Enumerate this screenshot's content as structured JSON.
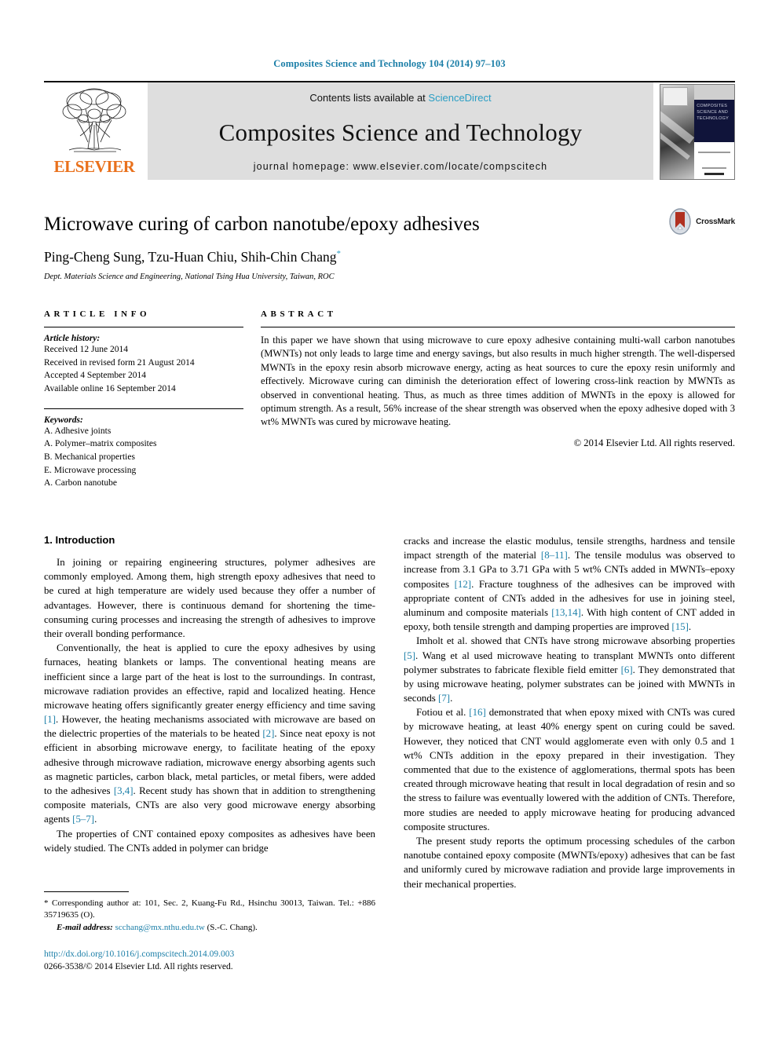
{
  "running_head": "Composites Science and Technology 104 (2014) 97–103",
  "banner": {
    "publisher_name": "ELSEVIER",
    "contents_prefix": "Contents lists available at",
    "contents_link": "ScienceDirect",
    "journal_title": "Composites Science and Technology",
    "homepage_line": "journal homepage: www.elsevier.com/locate/compscitech",
    "cover_title": "COMPOSITES SCIENCE AND TECHNOLOGY"
  },
  "article": {
    "title": "Microwave curing of carbon nanotube/epoxy adhesives",
    "authors": "Ping-Cheng Sung, Tzu-Huan Chiu, Shih-Chin Chang",
    "corresponding_marker": "*",
    "affiliation": "Dept. Materials Science and Engineering, National Tsing Hua University, Taiwan, ROC",
    "crossmark_label": "CrossMark"
  },
  "article_info": {
    "heading": "ARTICLE INFO",
    "history_label": "Article history:",
    "history": [
      "Received 12 June 2014",
      "Received in revised form 21 August 2014",
      "Accepted 4 September 2014",
      "Available online 16 September 2014"
    ],
    "keywords_label": "Keywords:",
    "keywords": [
      "A. Adhesive joints",
      "A. Polymer–matrix composites",
      "B. Mechanical properties",
      "E. Microwave processing",
      "A. Carbon nanotube"
    ]
  },
  "abstract": {
    "heading": "ABSTRACT",
    "text": "In this paper we have shown that using microwave to cure epoxy adhesive containing multi-wall carbon nanotubes (MWNTs) not only leads to large time and energy savings, but also results in much higher strength. The well-dispersed MWNTs in the epoxy resin absorb microwave energy, acting as heat sources to cure the epoxy resin uniformly and effectively. Microwave curing can diminish the deterioration effect of lowering cross-link reaction by MWNTs as observed in conventional heating. Thus, as much as three times addition of MWNTs in the epoxy is allowed for optimum strength. As a result, 56% increase of the shear strength was observed when the epoxy adhesive doped with 3 wt% MWNTs was cured by microwave heating.",
    "copyright": "© 2014 Elsevier Ltd. All rights reserved."
  },
  "body": {
    "section_number_title": "1. Introduction",
    "left_paragraphs": [
      "In joining or repairing engineering structures, polymer adhesives are commonly employed. Among them, high strength epoxy adhesives that need to be cured at high temperature are widely used because they offer a number of advantages. However, there is continuous demand for shortening the time-consuming curing processes and increasing the strength of adhesives to improve their overall bonding performance.",
      "Conventionally, the heat is applied to cure the epoxy adhesives by using furnaces, heating blankets or lamps. The conventional heating means are inefficient since a large part of the heat is lost to the surroundings. In contrast, microwave radiation provides an effective, rapid and localized heating. Hence microwave heating offers significantly greater energy efficiency and time saving [1]. However, the heating mechanisms associated with microwave are based on the dielectric properties of the materials to be heated [2]. Since neat epoxy is not efficient in absorbing microwave energy, to facilitate heating of the epoxy adhesive through microwave radiation, microwave energy absorbing agents such as magnetic particles, carbon black, metal particles, or metal fibers, were added to the adhesives [3,4]. Recent study has shown that in addition to strengthening composite materials, CNTs are also very good microwave energy absorbing agents [5–7].",
      "The properties of CNT contained epoxy composites as adhesives have been widely studied. The CNTs added in polymer can bridge"
    ],
    "right_paragraphs": [
      "cracks and increase the elastic modulus, tensile strengths, hardness and tensile impact strength of the material [8–11]. The tensile modulus was observed to increase from 3.1 GPa to 3.71 GPa with 5 wt% CNTs added in MWNTs–epoxy composites [12]. Fracture toughness of the adhesives can be improved with appropriate content of CNTs added in the adhesives for use in joining steel, aluminum and composite materials [13,14]. With high content of CNT added in epoxy, both tensile strength and damping properties are improved [15].",
      "Imholt et al. showed that CNTs have strong microwave absorbing properties [5]. Wang et al used microwave heating to transplant MWNTs onto different polymer substrates to fabricate flexible field emitter [6]. They demonstrated that by using microwave heating, polymer substrates can be joined with MWNTs in seconds [7].",
      "Fotiou et al. [16] demonstrated that when epoxy mixed with CNTs was cured by microwave heating, at least 40% energy spent on curing could be saved. However, they noticed that CNT would agglomerate even with only 0.5 and 1 wt% CNTs addition in the epoxy prepared in their investigation. They commented that due to the existence of agglomerations, thermal spots has been created through microwave heating that result in local degradation of resin and so the stress to failure was eventually lowered with the addition of CNTs. Therefore, more studies are needed to apply microwave heating for producing advanced composite structures.",
      "The present study reports the optimum processing schedules of the carbon nanotube contained epoxy composite (MWNTs/epoxy) adhesives that can be fast and uniformly cured by microwave radiation and provide large improvements in their mechanical properties."
    ]
  },
  "footnote": {
    "corresponding_marker": "*",
    "corresponding_text": "Corresponding author at: 101, Sec. 2, Kuang-Fu Rd., Hsinchu 30013, Taiwan. Tel.: +886 35719635 (O).",
    "email_label": "E-mail address:",
    "email": "scchang@mx.nthu.edu.tw",
    "email_owner": "(S.-C. Chang).",
    "doi": "http://dx.doi.org/10.1016/j.compscitech.2014.09.003",
    "issn_copyright": "0266-3538/© 2014 Elsevier Ltd. All rights reserved."
  },
  "colors": {
    "link_blue": "#1c7fa8",
    "science_direct_blue": "#2a9ec4",
    "elsevier_orange": "#E9711C",
    "crossmark_red": "#b03020",
    "banner_grey": "#dedede"
  }
}
